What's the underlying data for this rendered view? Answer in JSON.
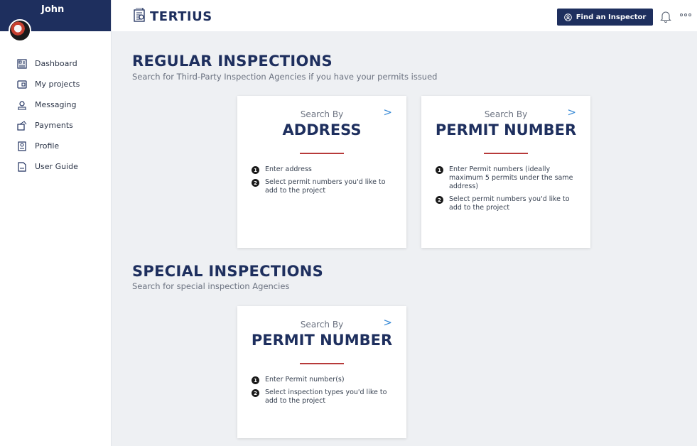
{
  "sidebar": {
    "user_name": "John",
    "items": [
      {
        "label": "Dashboard",
        "icon": "dashboard-icon"
      },
      {
        "label": "My projects",
        "icon": "projects-icon"
      },
      {
        "label": "Messaging",
        "icon": "messaging-icon"
      },
      {
        "label": "Payments",
        "icon": "payments-icon"
      },
      {
        "label": "Profile",
        "icon": "profile-icon"
      },
      {
        "label": "User Guide",
        "icon": "pdf-icon"
      }
    ]
  },
  "topbar": {
    "logo_text": "TERTIUS",
    "find_label": "Find an Inspector"
  },
  "regular": {
    "title": "REGULAR INSPECTIONS",
    "subtitle": "Search for Third-Party Inspection Agencies if you have your permits issued",
    "cards": [
      {
        "search_by": "Search By",
        "heading": "ADDRESS",
        "steps": [
          "Enter address",
          "Select permit numbers you'd like to add to the project"
        ]
      },
      {
        "search_by": "Search By",
        "heading": "PERMIT NUMBER",
        "steps": [
          "Enter Permit numbers (ideally maximum 5 permits under the same address)",
          "Select permit numbers you'd like to add to the project"
        ]
      }
    ]
  },
  "special": {
    "title": "SPECIAL INSPECTIONS",
    "subtitle": "Search for special inspection Agencies",
    "cards": [
      {
        "search_by": "Search By",
        "heading": "PERMIT NUMBER",
        "steps": [
          "Enter Permit number(s)",
          "Select inspection types you'd like to add to the project"
        ]
      }
    ]
  },
  "colors": {
    "navy": "#1e2f5e",
    "accent_red": "#b73a3a",
    "link_blue": "#3a8bd6"
  }
}
